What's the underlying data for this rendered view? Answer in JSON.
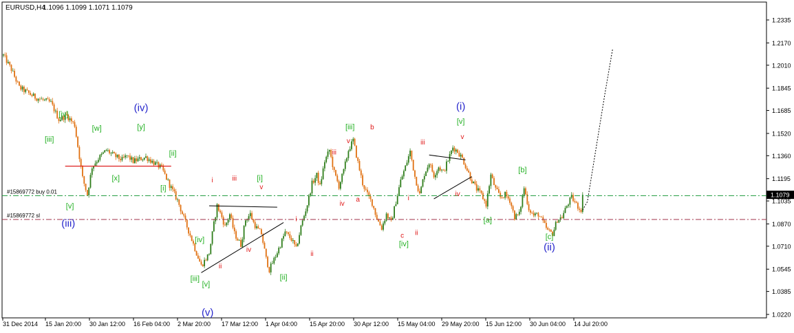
{
  "header": {
    "symbol": "EURUSD,H4",
    "ohlc": "1.1096 1.1099 1.1071 1.1079"
  },
  "colors": {
    "background": "#ffffff",
    "frame": "#000000",
    "candle_up": "#2e7d1a",
    "candle_down": "#e07010",
    "wave_green": "#22b022",
    "wave_red": "#e01818",
    "wave_blue": "#2626cc",
    "support_line": "#dd2020",
    "buy_line": "#1a9a3a",
    "sl_line": "#a0304a",
    "current_price_tag": "#000000"
  },
  "chart_data": {
    "type": "candlestick",
    "timeframe": "H4",
    "y_axis": {
      "ticks": [
        "1.2335",
        "1.2170",
        "1.2010",
        "1.1845",
        "1.1685",
        "1.1520",
        "1.1360",
        "1.1195",
        "1.1035",
        "1.0870",
        "1.0710",
        "1.0545",
        "1.0385",
        "1.0220"
      ],
      "current_price": "1.1079",
      "ylim": [
        1.022,
        1.2335
      ]
    },
    "x_axis": {
      "ticks": [
        "31 Dec 2014",
        "15 Jan 20:00",
        "30 Jan 12:00",
        "16 Feb 04:00",
        "2 Mar 20:00",
        "17 Mar 12:00",
        "1 Apr 04:00",
        "15 Apr 20:00",
        "30 Apr 12:00",
        "15 May 04:00",
        "29 May 20:00",
        "15 Jun 12:00",
        "30 Jun 04:00",
        "14 Jul 20:00"
      ]
    },
    "price_path": [
      [
        0,
        1.208
      ],
      [
        5,
        1.198
      ],
      [
        10,
        1.185
      ],
      [
        20,
        1.178
      ],
      [
        30,
        1.174
      ],
      [
        35,
        1.162
      ],
      [
        40,
        1.165
      ],
      [
        45,
        1.158
      ],
      [
        50,
        1.12
      ],
      [
        53,
        1.108
      ],
      [
        56,
        1.128
      ],
      [
        60,
        1.134
      ],
      [
        65,
        1.14
      ],
      [
        70,
        1.136
      ],
      [
        75,
        1.133
      ],
      [
        78,
        1.136
      ],
      [
        82,
        1.132
      ],
      [
        90,
        1.135
      ],
      [
        95,
        1.131
      ],
      [
        100,
        1.127
      ],
      [
        105,
        1.115
      ],
      [
        110,
        1.104
      ],
      [
        115,
        1.088
      ],
      [
        118,
        1.079
      ],
      [
        122,
        1.066
      ],
      [
        125,
        1.057
      ],
      [
        128,
        1.062
      ],
      [
        130,
        1.066
      ],
      [
        133,
        1.087
      ],
      [
        135,
        1.1
      ],
      [
        138,
        1.092
      ],
      [
        140,
        1.085
      ],
      [
        143,
        1.094
      ],
      [
        146,
        1.08
      ],
      [
        150,
        1.072
      ],
      [
        153,
        1.09
      ],
      [
        156,
        1.094
      ],
      [
        158,
        1.088
      ],
      [
        160,
        1.084
      ],
      [
        163,
        1.08
      ],
      [
        166,
        1.062
      ],
      [
        168,
        1.054
      ],
      [
        172,
        1.064
      ],
      [
        175,
        1.072
      ],
      [
        178,
        1.081
      ],
      [
        182,
        1.076
      ],
      [
        185,
        1.069
      ],
      [
        188,
        1.085
      ],
      [
        192,
        1.101
      ],
      [
        195,
        1.116
      ],
      [
        198,
        1.122
      ],
      [
        200,
        1.114
      ],
      [
        203,
        1.132
      ],
      [
        206,
        1.14
      ],
      [
        209,
        1.124
      ],
      [
        212,
        1.114
      ],
      [
        215,
        1.125
      ],
      [
        218,
        1.14
      ],
      [
        221,
        1.147
      ],
      [
        224,
        1.131
      ],
      [
        227,
        1.116
      ],
      [
        230,
        1.108
      ],
      [
        233,
        1.102
      ],
      [
        236,
        1.091
      ],
      [
        239,
        1.084
      ],
      [
        242,
        1.094
      ],
      [
        245,
        1.088
      ],
      [
        248,
        1.103
      ],
      [
        251,
        1.118
      ],
      [
        254,
        1.128
      ],
      [
        257,
        1.139
      ],
      [
        260,
        1.121
      ],
      [
        263,
        1.108
      ],
      [
        266,
        1.123
      ],
      [
        269,
        1.131
      ],
      [
        272,
        1.122
      ],
      [
        275,
        1.128
      ],
      [
        278,
        1.124
      ],
      [
        281,
        1.133
      ],
      [
        284,
        1.142
      ],
      [
        287,
        1.139
      ],
      [
        290,
        1.134
      ],
      [
        293,
        1.126
      ],
      [
        296,
        1.118
      ],
      [
        299,
        1.112
      ],
      [
        302,
        1.108
      ],
      [
        305,
        1.101
      ],
      [
        308,
        1.122
      ],
      [
        311,
        1.112
      ],
      [
        314,
        1.106
      ],
      [
        317,
        1.108
      ],
      [
        320,
        1.104
      ],
      [
        323,
        1.092
      ],
      [
        326,
        1.094
      ],
      [
        329,
        1.113
      ],
      [
        332,
        1.098
      ],
      [
        335,
        1.093
      ],
      [
        338,
        1.094
      ],
      [
        341,
        1.088
      ],
      [
        344,
        1.082
      ],
      [
        347,
        1.08
      ],
      [
        350,
        1.09
      ],
      [
        353,
        1.092
      ],
      [
        356,
        1.1
      ],
      [
        359,
        1.106
      ],
      [
        362,
        1.101
      ],
      [
        364,
        1.098
      ],
      [
        366,
        1.097
      ]
    ],
    "projection": [
      [
        366,
        1.097
      ],
      [
        369,
        1.103
      ],
      [
        375,
        1.145
      ],
      [
        380,
        1.18
      ],
      [
        385,
        1.213
      ]
    ],
    "trend_lines": [
      {
        "from": [
          130,
          1.1
        ],
        "to": [
          173,
          1.099
        ]
      },
      {
        "from": [
          125,
          1.052
        ],
        "to": [
          177,
          1.088
        ]
      },
      {
        "from": [
          269,
          1.1365
        ],
        "to": [
          292,
          1.133
        ]
      },
      {
        "from": [
          272,
          1.105
        ],
        "to": [
          296,
          1.121
        ]
      }
    ],
    "support_line": {
      "from": [
        39,
        1.1285
      ],
      "to": [
        106,
        1.1285
      ]
    },
    "wave_labels": [
      {
        "text": "[iv]",
        "x": 38,
        "y": 1.164,
        "color": "green"
      },
      {
        "text": "[iii]",
        "x": 29,
        "y": 1.146,
        "color": "green"
      },
      {
        "text": "[v]",
        "x": 42,
        "y": 1.098,
        "color": "green"
      },
      {
        "text": "(iii)",
        "x": 41,
        "y": 1.085,
        "color": "blue"
      },
      {
        "text": "[w]",
        "x": 59,
        "y": 1.154,
        "color": "green"
      },
      {
        "text": "(iv)",
        "x": 87,
        "y": 1.168,
        "color": "blue"
      },
      {
        "text": "[y]",
        "x": 87,
        "y": 1.155,
        "color": "green"
      },
      {
        "text": "[x]",
        "x": 71,
        "y": 1.118,
        "color": "green"
      },
      {
        "text": "[ii]",
        "x": 107,
        "y": 1.136,
        "color": "green"
      },
      {
        "text": "[i]",
        "x": 101,
        "y": 1.111,
        "color": "green"
      },
      {
        "text": "[iv]",
        "x": 124,
        "y": 1.074,
        "color": "green"
      },
      {
        "text": "[iii]",
        "x": 121,
        "y": 1.046,
        "color": "green"
      },
      {
        "text": "[v]",
        "x": 128,
        "y": 1.042,
        "color": "green"
      },
      {
        "text": "(v)",
        "x": 129,
        "y": 1.021,
        "color": "blue"
      },
      {
        "text": "i",
        "x": 132,
        "y": 1.117,
        "color": "red"
      },
      {
        "text": "iii",
        "x": 146,
        "y": 1.118,
        "color": "red"
      },
      {
        "text": "[i]",
        "x": 162,
        "y": 1.118,
        "color": "green"
      },
      {
        "text": "v",
        "x": 163,
        "y": 1.112,
        "color": "red"
      },
      {
        "text": "ii",
        "x": 137,
        "y": 1.055,
        "color": "red"
      },
      {
        "text": "iv",
        "x": 155,
        "y": 1.067,
        "color": "red"
      },
      {
        "text": "[ii]",
        "x": 177,
        "y": 1.047,
        "color": "green"
      },
      {
        "text": "i",
        "x": 185,
        "y": 1.089,
        "color": "red"
      },
      {
        "text": "ii",
        "x": 195,
        "y": 1.064,
        "color": "red"
      },
      {
        "text": "iii",
        "x": 209,
        "y": 1.137,
        "color": "red"
      },
      {
        "text": "iv",
        "x": 214,
        "y": 1.1,
        "color": "red"
      },
      {
        "text": "[iii]",
        "x": 219,
        "y": 1.155,
        "color": "green"
      },
      {
        "text": "v",
        "x": 218,
        "y": 1.145,
        "color": "red"
      },
      {
        "text": "a",
        "x": 224,
        "y": 1.103,
        "color": "red"
      },
      {
        "text": "b",
        "x": 233,
        "y": 1.155,
        "color": "red"
      },
      {
        "text": "c",
        "x": 252,
        "y": 1.077,
        "color": "red"
      },
      {
        "text": "[iv]",
        "x": 253,
        "y": 1.071,
        "color": "green"
      },
      {
        "text": "i",
        "x": 256,
        "y": 1.104,
        "color": "red"
      },
      {
        "text": "ii",
        "x": 261,
        "y": 1.079,
        "color": "red"
      },
      {
        "text": "iii",
        "x": 265,
        "y": 1.144,
        "color": "red"
      },
      {
        "text": "iv",
        "x": 287,
        "y": 1.107,
        "color": "red"
      },
      {
        "text": "(i)",
        "x": 289,
        "y": 1.169,
        "color": "blue"
      },
      {
        "text": "[v]",
        "x": 289,
        "y": 1.159,
        "color": "green"
      },
      {
        "text": "v",
        "x": 290,
        "y": 1.148,
        "color": "red"
      },
      {
        "text": "[a]",
        "x": 306,
        "y": 1.088,
        "color": "green"
      },
      {
        "text": "[b]",
        "x": 328,
        "y": 1.124,
        "color": "green"
      },
      {
        "text": "[c]",
        "x": 345,
        "y": 1.076,
        "color": "green"
      },
      {
        "text": "(ii)",
        "x": 345,
        "y": 1.068,
        "color": "blue"
      }
    ],
    "price_lines": [
      {
        "label": "#15869772 buy 0.01",
        "price": 1.1073,
        "style": "dash-dot",
        "color": "green"
      },
      {
        "label": "#15869772 sl",
        "price": 1.0902,
        "style": "dash-dot",
        "color": "red"
      }
    ],
    "grid": false
  }
}
